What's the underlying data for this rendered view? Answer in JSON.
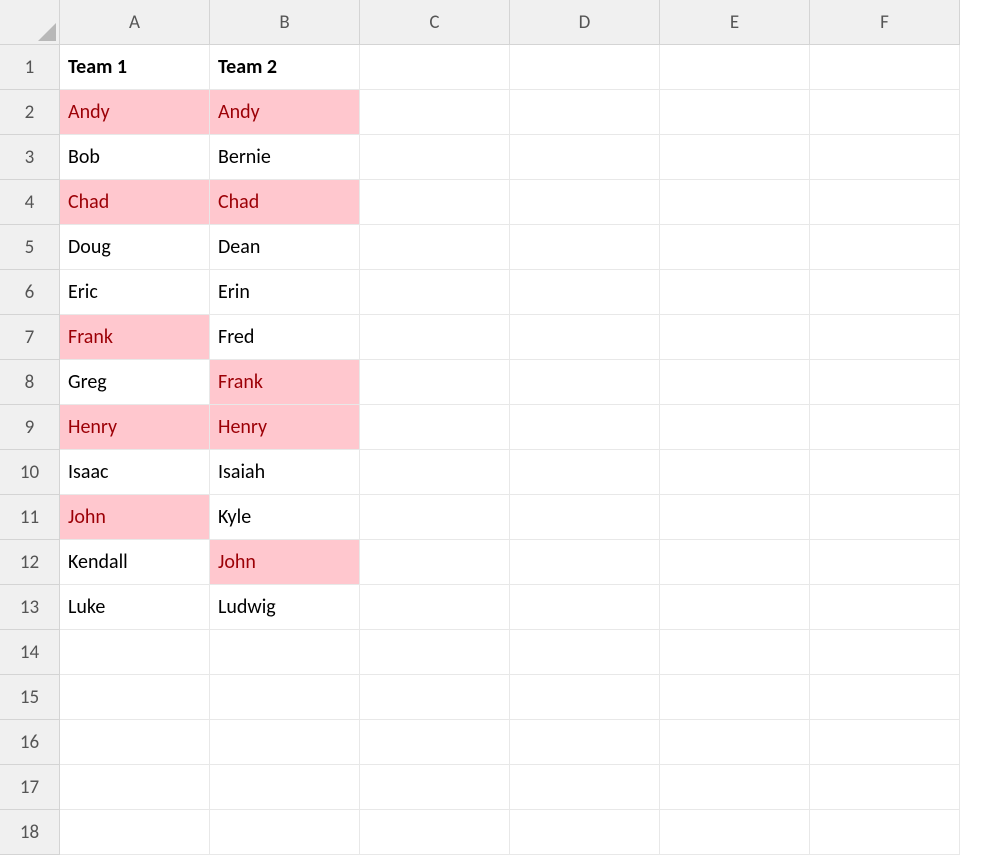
{
  "colors": {
    "highlight_fill": "#ffc7ce",
    "highlight_font": "#9c0006"
  },
  "chart_data": {
    "type": "table",
    "columns": [
      "A",
      "B",
      "C",
      "D",
      "E",
      "F"
    ],
    "rows_shown": 18,
    "headers": {
      "A": "Team 1",
      "B": "Team 2"
    },
    "data": [
      {
        "row": 2,
        "A": {
          "value": "Andy",
          "highlight": true
        },
        "B": {
          "value": "Andy",
          "highlight": true
        }
      },
      {
        "row": 3,
        "A": {
          "value": "Bob",
          "highlight": false
        },
        "B": {
          "value": "Bernie",
          "highlight": false
        }
      },
      {
        "row": 4,
        "A": {
          "value": "Chad",
          "highlight": true
        },
        "B": {
          "value": "Chad",
          "highlight": true
        }
      },
      {
        "row": 5,
        "A": {
          "value": "Doug",
          "highlight": false
        },
        "B": {
          "value": "Dean",
          "highlight": false
        }
      },
      {
        "row": 6,
        "A": {
          "value": "Eric",
          "highlight": false
        },
        "B": {
          "value": "Erin",
          "highlight": false
        }
      },
      {
        "row": 7,
        "A": {
          "value": "Frank",
          "highlight": true
        },
        "B": {
          "value": "Fred",
          "highlight": false
        }
      },
      {
        "row": 8,
        "A": {
          "value": "Greg",
          "highlight": false
        },
        "B": {
          "value": "Frank",
          "highlight": true
        }
      },
      {
        "row": 9,
        "A": {
          "value": "Henry",
          "highlight": true
        },
        "B": {
          "value": "Henry",
          "highlight": true
        }
      },
      {
        "row": 10,
        "A": {
          "value": "Isaac",
          "highlight": false
        },
        "B": {
          "value": "Isaiah",
          "highlight": false
        }
      },
      {
        "row": 11,
        "A": {
          "value": "John",
          "highlight": true
        },
        "B": {
          "value": "Kyle",
          "highlight": false
        }
      },
      {
        "row": 12,
        "A": {
          "value": "Kendall",
          "highlight": false
        },
        "B": {
          "value": "John",
          "highlight": true
        }
      },
      {
        "row": 13,
        "A": {
          "value": "Luke",
          "highlight": false
        },
        "B": {
          "value": "Ludwig",
          "highlight": false
        }
      }
    ]
  }
}
